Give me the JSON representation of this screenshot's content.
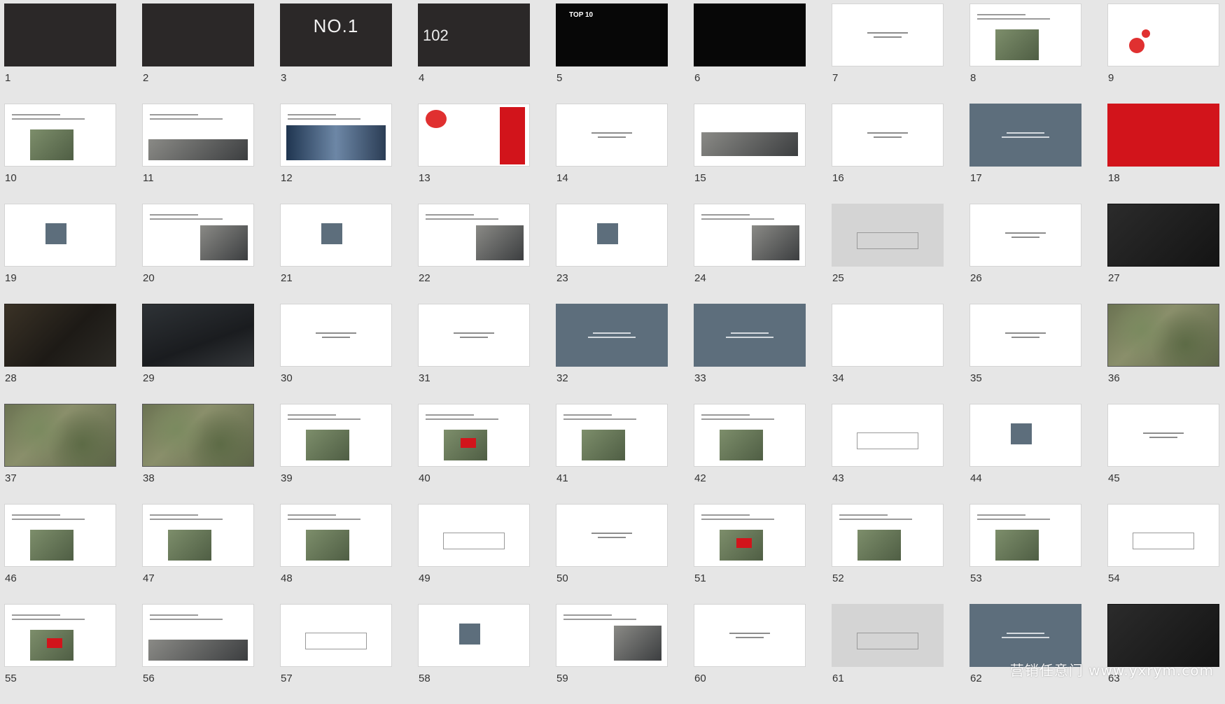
{
  "slides": [
    {
      "number": "1",
      "theme": "dark"
    },
    {
      "number": "2",
      "theme": "dark"
    },
    {
      "number": "3",
      "theme": "dark",
      "title": "NO.1"
    },
    {
      "number": "4",
      "theme": "dark",
      "title": "102"
    },
    {
      "number": "5",
      "theme": "black",
      "title": "TOP 10"
    },
    {
      "number": "6",
      "theme": "black"
    },
    {
      "number": "7",
      "theme": "white"
    },
    {
      "number": "8",
      "theme": "white"
    },
    {
      "number": "9",
      "theme": "white"
    },
    {
      "number": "10",
      "theme": "white"
    },
    {
      "number": "11",
      "theme": "white"
    },
    {
      "number": "12",
      "theme": "white"
    },
    {
      "number": "13",
      "theme": "white"
    },
    {
      "number": "14",
      "theme": "white"
    },
    {
      "number": "15",
      "theme": "white"
    },
    {
      "number": "16",
      "theme": "white"
    },
    {
      "number": "17",
      "theme": "slate"
    },
    {
      "number": "18",
      "theme": "red"
    },
    {
      "number": "19",
      "theme": "white"
    },
    {
      "number": "20",
      "theme": "white"
    },
    {
      "number": "21",
      "theme": "white"
    },
    {
      "number": "22",
      "theme": "white"
    },
    {
      "number": "23",
      "theme": "white"
    },
    {
      "number": "24",
      "theme": "white"
    },
    {
      "number": "25",
      "theme": "gray"
    },
    {
      "number": "26",
      "theme": "white"
    },
    {
      "number": "27",
      "theme": "stone"
    },
    {
      "number": "28",
      "theme": "photo-dark"
    },
    {
      "number": "29",
      "theme": "night"
    },
    {
      "number": "30",
      "theme": "white"
    },
    {
      "number": "31",
      "theme": "white"
    },
    {
      "number": "32",
      "theme": "slate"
    },
    {
      "number": "33",
      "theme": "slate"
    },
    {
      "number": "34",
      "theme": "white"
    },
    {
      "number": "35",
      "theme": "white"
    },
    {
      "number": "36",
      "theme": "satellite"
    },
    {
      "number": "37",
      "theme": "satellite"
    },
    {
      "number": "38",
      "theme": "satellite"
    },
    {
      "number": "39",
      "theme": "white"
    },
    {
      "number": "40",
      "theme": "white"
    },
    {
      "number": "41",
      "theme": "white"
    },
    {
      "number": "42",
      "theme": "white"
    },
    {
      "number": "43",
      "theme": "white"
    },
    {
      "number": "44",
      "theme": "white"
    },
    {
      "number": "45",
      "theme": "white"
    },
    {
      "number": "46",
      "theme": "white"
    },
    {
      "number": "47",
      "theme": "white"
    },
    {
      "number": "48",
      "theme": "white"
    },
    {
      "number": "49",
      "theme": "white"
    },
    {
      "number": "50",
      "theme": "white"
    },
    {
      "number": "51",
      "theme": "white"
    },
    {
      "number": "52",
      "theme": "white"
    },
    {
      "number": "53",
      "theme": "white"
    },
    {
      "number": "54",
      "theme": "white"
    },
    {
      "number": "55",
      "theme": "white"
    },
    {
      "number": "56",
      "theme": "white"
    },
    {
      "number": "57",
      "theme": "white"
    },
    {
      "number": "58",
      "theme": "white"
    },
    {
      "number": "59",
      "theme": "white"
    },
    {
      "number": "60",
      "theme": "white"
    },
    {
      "number": "61",
      "theme": "gray"
    },
    {
      "number": "62",
      "theme": "slate"
    },
    {
      "number": "63",
      "theme": "stone"
    }
  ],
  "watermark": "营销任意门 www.yxrym.com",
  "colors": {
    "background": "#e6e6e6",
    "slate": "#5d6e7c",
    "accent_red": "#d2141b",
    "dark": "#2b2828"
  }
}
